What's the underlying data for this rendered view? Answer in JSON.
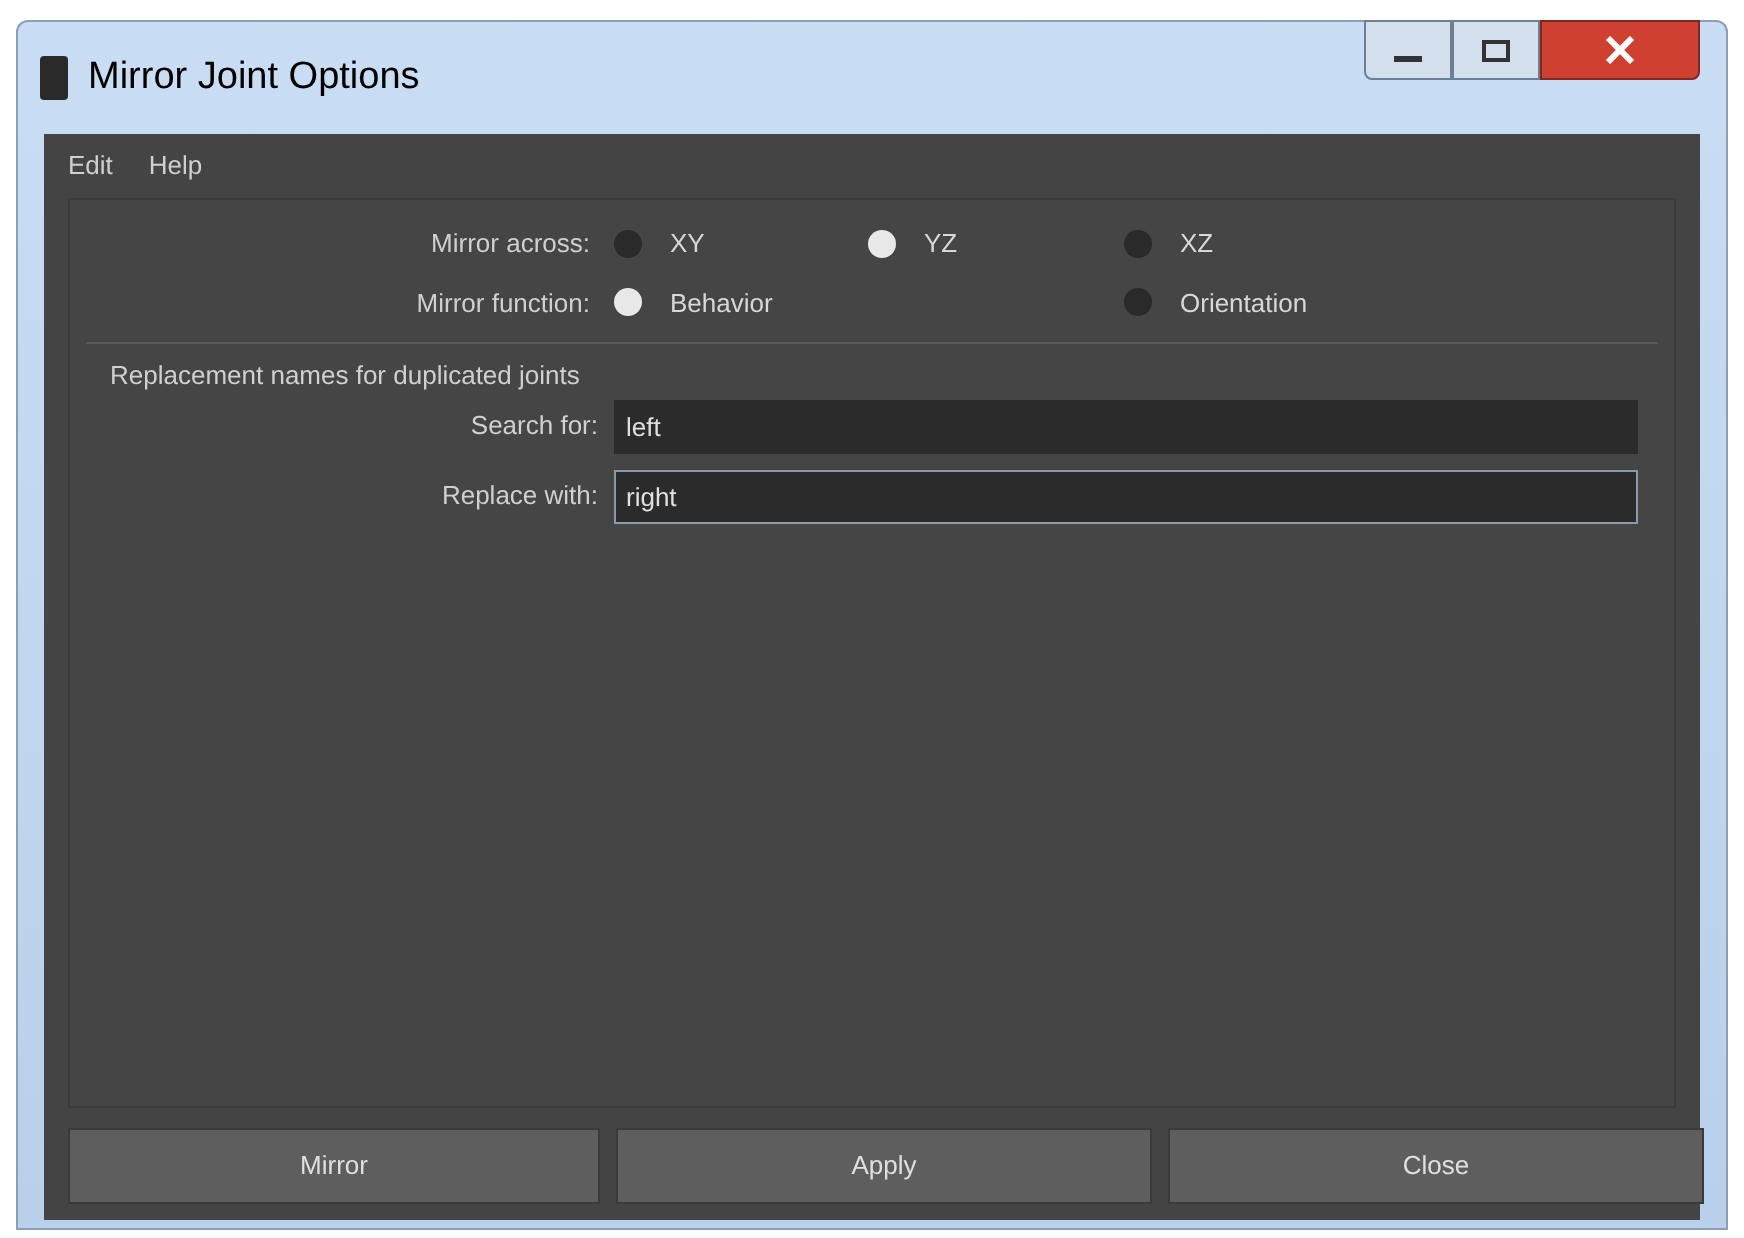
{
  "window": {
    "title": "Mirror Joint Options"
  },
  "menu": [
    "Edit",
    "Help"
  ],
  "radio_groups": [
    {
      "label": "Mirror across:",
      "options": [
        {
          "label": "XY",
          "selected": false
        },
        {
          "label": "YZ",
          "selected": true
        },
        {
          "label": "XZ",
          "selected": false
        }
      ]
    },
    {
      "label": "Mirror function:",
      "options": [
        {
          "label": "Behavior",
          "selected": true
        },
        {
          "label": "Orientation",
          "selected": false
        }
      ]
    }
  ],
  "section": {
    "title": "Replacement names for duplicated joints"
  },
  "fields": [
    {
      "label": "Search for:",
      "value": "left",
      "focused": false
    },
    {
      "label": "Replace with:",
      "value": "right",
      "focused": true
    }
  ],
  "buttons": [
    "Mirror",
    "Apply",
    "Close"
  ]
}
